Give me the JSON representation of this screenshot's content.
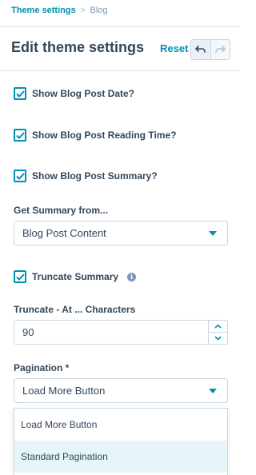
{
  "breadcrumb": {
    "parent": "Theme settings",
    "separator": ">",
    "current": "Blog"
  },
  "header": {
    "title": "Edit theme settings",
    "reset_label": "Reset"
  },
  "checkboxes": [
    {
      "label": "Show Blog Post Date?",
      "checked": true
    },
    {
      "label": "Show Blog Post Reading Time?",
      "checked": true
    },
    {
      "label": "Show Blog Post Summary?",
      "checked": true
    }
  ],
  "summary_source": {
    "label": "Get Summary from...",
    "value": "Blog Post Content"
  },
  "truncate_summary": {
    "label": "Truncate Summary",
    "checked": true,
    "info_icon": "i"
  },
  "truncate_at": {
    "label": "Truncate - At ... Characters",
    "value": "90"
  },
  "pagination": {
    "label": "Pagination *",
    "value": "Load More Button",
    "options": [
      "Load More Button",
      "Standard Pagination"
    ],
    "highlighted": "Standard Pagination"
  },
  "colors": {
    "accent": "#0091ae",
    "text": "#33475b",
    "border": "#cbd6e2",
    "highlight": "#e5f5f8"
  }
}
